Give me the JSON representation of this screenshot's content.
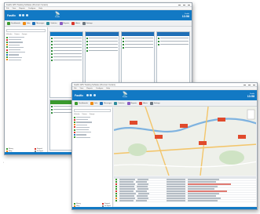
{
  "colors": {
    "brand_blue": "#1279c4",
    "tile_green": "#3a9a2e",
    "tile_orange": "#ef8a12",
    "tile_blue": "#1f6fb6",
    "map_marker": "#e04a2c",
    "error_red": "#d9342b"
  },
  "back_window": {
    "title": "Fastfix GPS Tracking Software (Premium Version)",
    "menu": [
      "File",
      "View",
      "Reports",
      "Configure",
      "Help"
    ],
    "header": {
      "title": "Fastfix",
      "center_small": "Fastfix",
      "right_small": "Fastfix",
      "right_big": "13:58"
    },
    "toolbar": [
      "Dashboards",
      "Jobs",
      "Messages",
      "Vehicles",
      "Reports",
      "Alerts",
      "Settings"
    ],
    "sidebar": {
      "tabs": [
        "Vehicles",
        "Drivers",
        "Groups"
      ],
      "legend": [
        "Moving",
        "Stopped",
        "Idling",
        "No Signal"
      ]
    }
  },
  "front_window": {
    "title": "Fastfix GPS Tracking Software (Premium Version)",
    "menu": [
      "File",
      "View",
      "Reports",
      "Configure",
      "Help"
    ],
    "header": {
      "title": "Fastfix",
      "center_small": "Fastfix",
      "right_small": "Fastfix",
      "right_big": "13:58"
    },
    "toolbar": [
      "Dashboards",
      "Jobs",
      "Messages",
      "Vehicles",
      "Reports",
      "Alerts",
      "Settings"
    ],
    "sidebar": {
      "tabs": [
        "Vehicles",
        "Drivers",
        "Groups"
      ],
      "legend": [
        "Moving",
        "Stopped",
        "Idling",
        "No Signal"
      ]
    }
  }
}
